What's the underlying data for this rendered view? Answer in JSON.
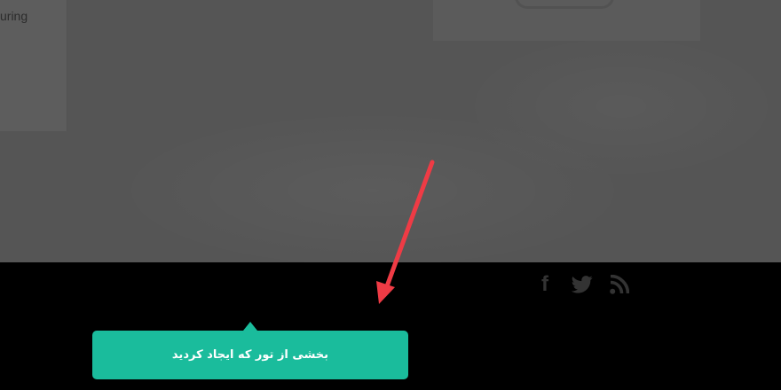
{
  "page": {
    "left_card_text": "uring"
  },
  "footer": {
    "social": [
      {
        "icon": "facebook-icon",
        "label": "f"
      },
      {
        "icon": "twitter-icon"
      },
      {
        "icon": "rss-icon"
      }
    ],
    "icon_color": "#333333"
  },
  "tour": {
    "tooltip_text": "بخشی از تور که ایجاد کردید",
    "tooltip_color": "#1abc9c"
  },
  "annotation": {
    "arrow_color": "#ef3b45"
  }
}
